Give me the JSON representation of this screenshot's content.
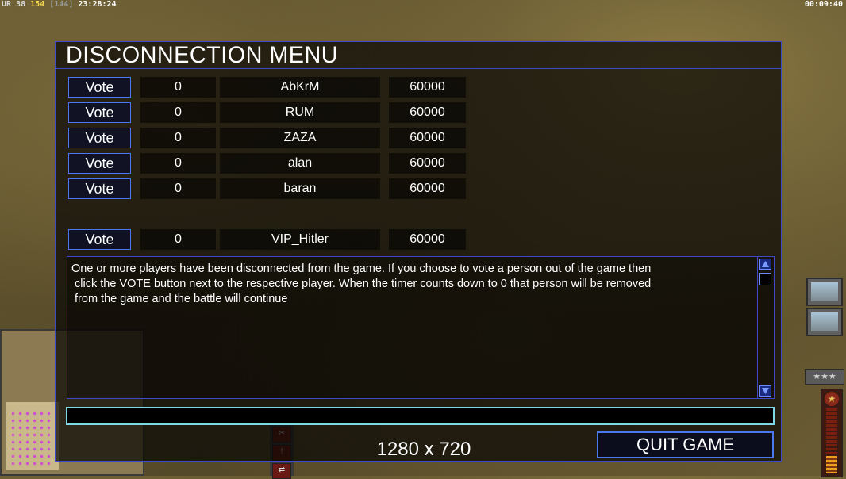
{
  "hud": {
    "left_segments": [
      "UR",
      "38",
      "154",
      "[144]",
      "23:28:24"
    ],
    "right_time": "00:09:40"
  },
  "side_hud": {
    "rank_badge": "★★★",
    "star_icon": "★",
    "bottom_buttons": [
      "✂",
      "!",
      "⇄"
    ]
  },
  "dialog": {
    "title": "DISCONNECTION MENU",
    "players": [
      {
        "vote_label": "Vote",
        "votes": "0",
        "name": "AbKrM",
        "timer": "60000"
      },
      {
        "vote_label": "Vote",
        "votes": "0",
        "name": "RUM",
        "timer": "60000"
      },
      {
        "vote_label": "Vote",
        "votes": "0",
        "name": "ZAZA",
        "timer": "60000"
      },
      {
        "vote_label": "Vote",
        "votes": "0",
        "name": "alan",
        "timer": "60000"
      },
      {
        "vote_label": "Vote",
        "votes": "0",
        "name": "baran",
        "timer": "60000"
      },
      {
        "vote_label": "Vote",
        "votes": "0",
        "name": "VIP_Hitler",
        "timer": "60000"
      }
    ],
    "message": "One or more players have been disconnected from the game. If you choose to vote a person out of the game then\n click the VOTE button next to the respective player. When the timer counts down to 0 that person will be removed\n from the game and the battle will continue",
    "chat_value": "",
    "resolution": "1280 x 720",
    "quit_label": "QUIT GAME"
  },
  "colors": {
    "border": "#3f48c8",
    "vote_border": "#4b78f0",
    "input_border": "#7fd8e8",
    "hud_money": "#f3d34a"
  }
}
